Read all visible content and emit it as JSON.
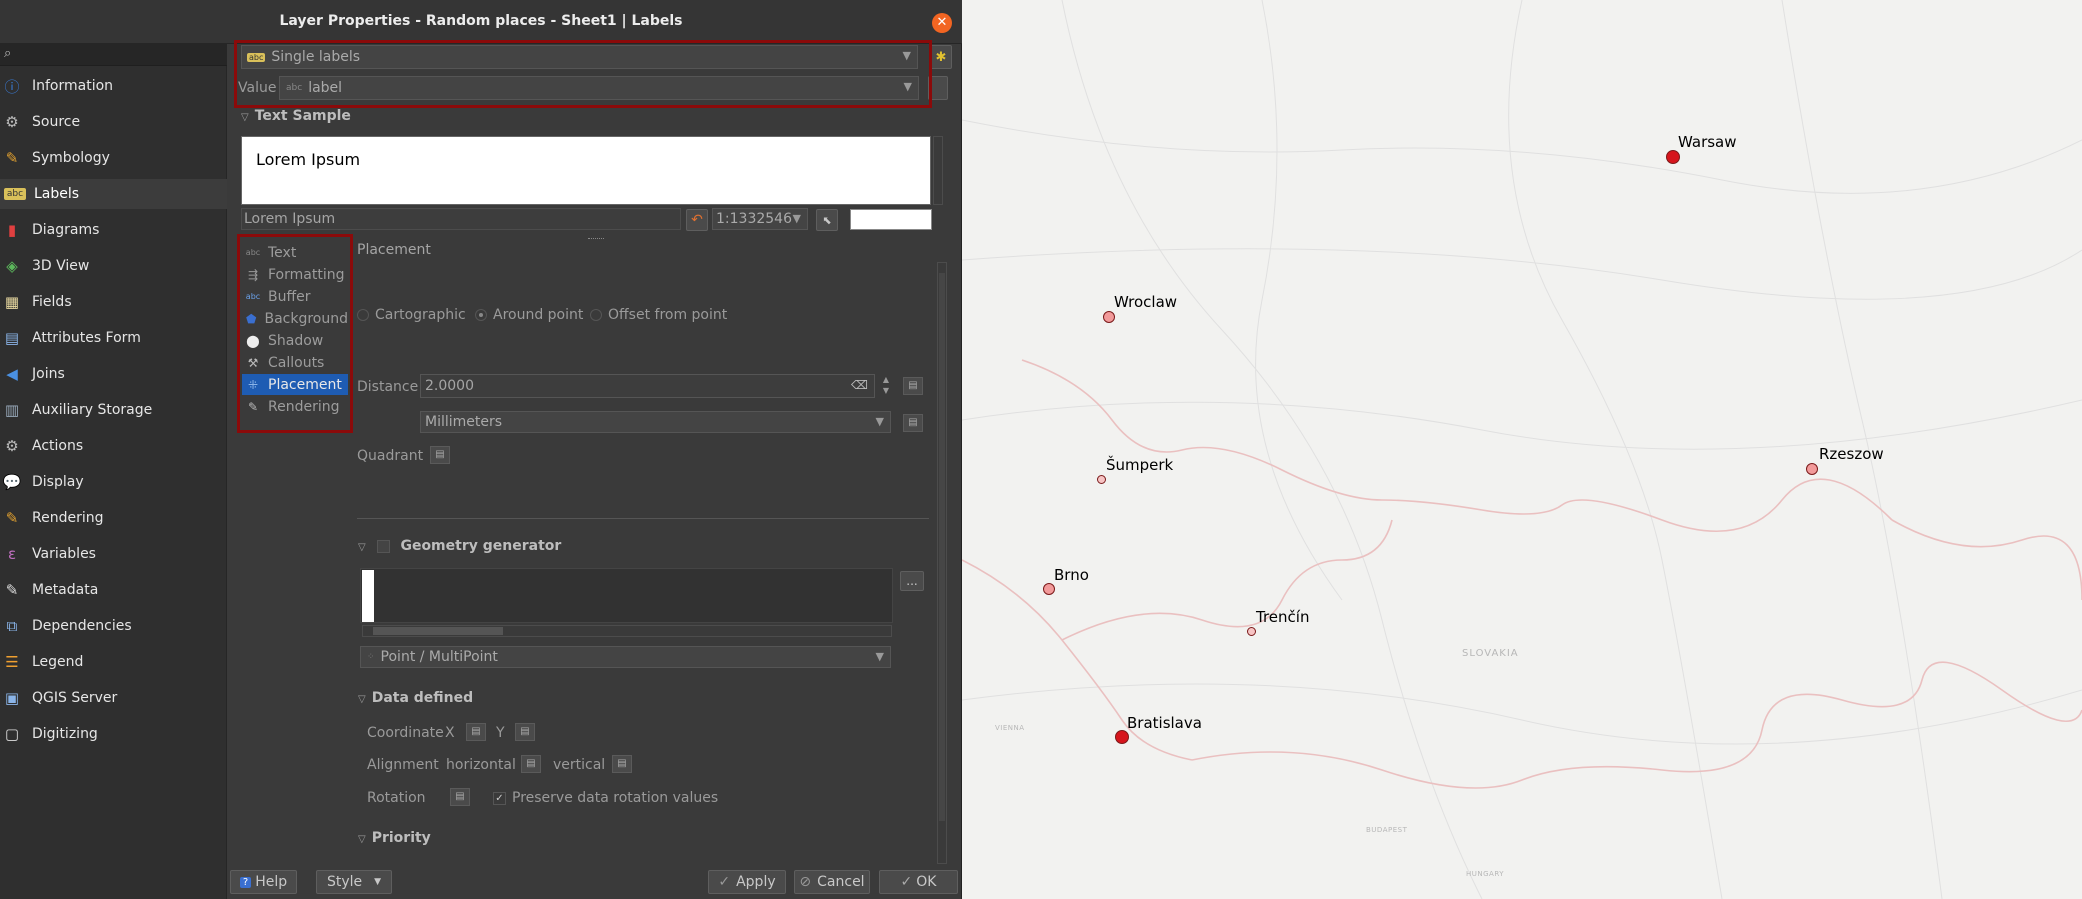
{
  "window": {
    "title": "Layer Properties - Random places - Sheet1 | Labels"
  },
  "sidebar": {
    "search_placeholder": "",
    "items": [
      {
        "label": "Information",
        "icon": "info-icon"
      },
      {
        "label": "Source",
        "icon": "source-icon"
      },
      {
        "label": "Symbology",
        "icon": "symbology-icon"
      },
      {
        "label": "Labels",
        "icon": "labels-icon",
        "active": true
      },
      {
        "label": "Diagrams",
        "icon": "diagrams-icon"
      },
      {
        "label": "3D View",
        "icon": "cube-icon"
      },
      {
        "label": "Fields",
        "icon": "fields-icon"
      },
      {
        "label": "Attributes Form",
        "icon": "form-icon"
      },
      {
        "label": "Joins",
        "icon": "joins-icon"
      },
      {
        "label": "Auxiliary Storage",
        "icon": "storage-icon"
      },
      {
        "label": "Actions",
        "icon": "actions-icon"
      },
      {
        "label": "Display",
        "icon": "display-icon"
      },
      {
        "label": "Rendering",
        "icon": "rendering-icon"
      },
      {
        "label": "Variables",
        "icon": "variables-icon"
      },
      {
        "label": "Metadata",
        "icon": "metadata-icon"
      },
      {
        "label": "Dependencies",
        "icon": "dependencies-icon"
      },
      {
        "label": "Legend",
        "icon": "legend-icon"
      },
      {
        "label": "QGIS Server",
        "icon": "server-icon"
      },
      {
        "label": "Digitizing",
        "icon": "digitizing-icon"
      }
    ]
  },
  "labels_mode": {
    "selected": "Single labels"
  },
  "value_field": {
    "label": "Value",
    "value": "label"
  },
  "text_sample": {
    "header": "Text Sample",
    "sample_text": "Lorem Ipsum",
    "input_value": "Lorem Ipsum",
    "scale": "1:1332546"
  },
  "tabs": [
    {
      "label": "Text",
      "icon": "text-icon"
    },
    {
      "label": "Formatting",
      "icon": "formatting-icon"
    },
    {
      "label": "Buffer",
      "icon": "buffer-icon"
    },
    {
      "label": "Background",
      "icon": "background-icon"
    },
    {
      "label": "Shadow",
      "icon": "shadow-icon"
    },
    {
      "label": "Callouts",
      "icon": "callouts-icon"
    },
    {
      "label": "Placement",
      "icon": "placement-icon",
      "active": true
    },
    {
      "label": "Rendering",
      "icon": "rendering-icon"
    }
  ],
  "placement": {
    "header": "Placement",
    "modes": [
      {
        "label": "Cartographic",
        "checked": false
      },
      {
        "label": "Around point",
        "checked": true
      },
      {
        "label": "Offset from point",
        "checked": false
      }
    ],
    "distance_label": "Distance",
    "distance_value": "2.0000",
    "units": "Millimeters",
    "quadrant_label": "Quadrant"
  },
  "geometry_generator": {
    "header": "Geometry generator",
    "geometry_type": "Point / MultiPoint",
    "more_button": "..."
  },
  "data_defined": {
    "header": "Data defined",
    "coordinate_label": "Coordinate",
    "x_label": "X",
    "y_label": "Y",
    "alignment_label": "Alignment",
    "horizontal_label": "horizontal",
    "vertical_label": "vertical",
    "rotation_label": "Rotation",
    "preserve_label": "Preserve data rotation values"
  },
  "priority": {
    "header": "Priority"
  },
  "footer": {
    "help": "Help",
    "style": "Style",
    "apply": "Apply",
    "cancel": "Cancel",
    "ok": "OK"
  },
  "map": {
    "cities": [
      {
        "name": "Warsaw",
        "size": "large"
      },
      {
        "name": "Wroclaw",
        "size": "medium"
      },
      {
        "name": "Rzeszow",
        "size": "medium"
      },
      {
        "name": "Šumperk",
        "size": "small"
      },
      {
        "name": "Brno",
        "size": "medium"
      },
      {
        "name": "Trenčín",
        "size": "small"
      },
      {
        "name": "Bratislava",
        "size": "large"
      }
    ],
    "country_labels": [
      "SLOVAKIA",
      "HUNGARY",
      "VIENNA",
      "BUDAPEST"
    ],
    "colors": {
      "large_dot": "#d6151c",
      "medium_dot": "#f29a9a",
      "small_dot": "#f7c4c4",
      "border": "#e8b5b5",
      "accent_red_frame": "#8b0a0a",
      "selected_tab": "#1e5cb3"
    }
  }
}
